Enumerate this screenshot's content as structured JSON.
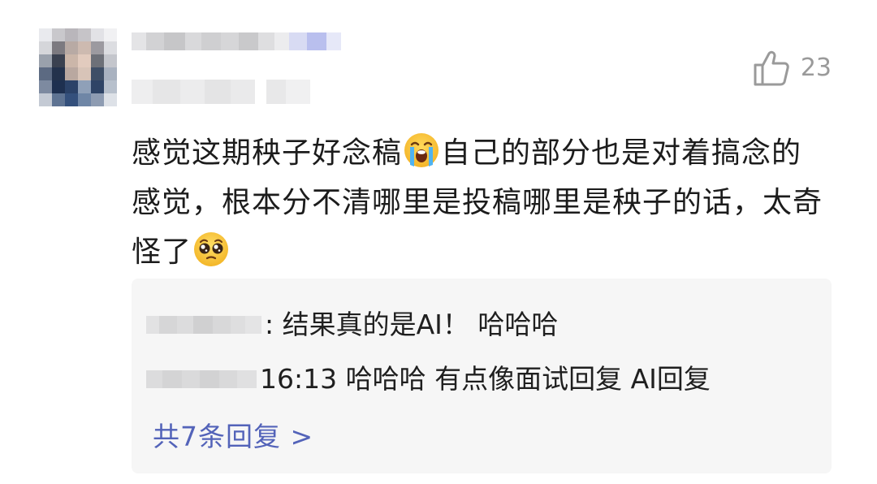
{
  "comment": {
    "avatar_icon": "user-avatar-pixelated",
    "like": {
      "icon": "thumbs-up-outline-icon",
      "count": "23"
    },
    "text_part1": "感觉这期秧子好念稿",
    "emoji1": "loudly-crying-face",
    "text_part2": "自己的部分也是对着搞念的感觉，根本分不清哪里是投稿哪里是秧子的话，太奇怪了",
    "emoji2": "pleading-face"
  },
  "replies": {
    "items": [
      {
        "text": ": 结果真的是AI！ 哈哈哈"
      },
      {
        "text": "16:13 哈哈哈 有点像面试回复 AI回复"
      }
    ],
    "more_label": "共7条回复 >"
  },
  "colors": {
    "link": "#5363b9",
    "like_gray": "#9a9a9a",
    "reply_bg": "#f6f6f6"
  }
}
